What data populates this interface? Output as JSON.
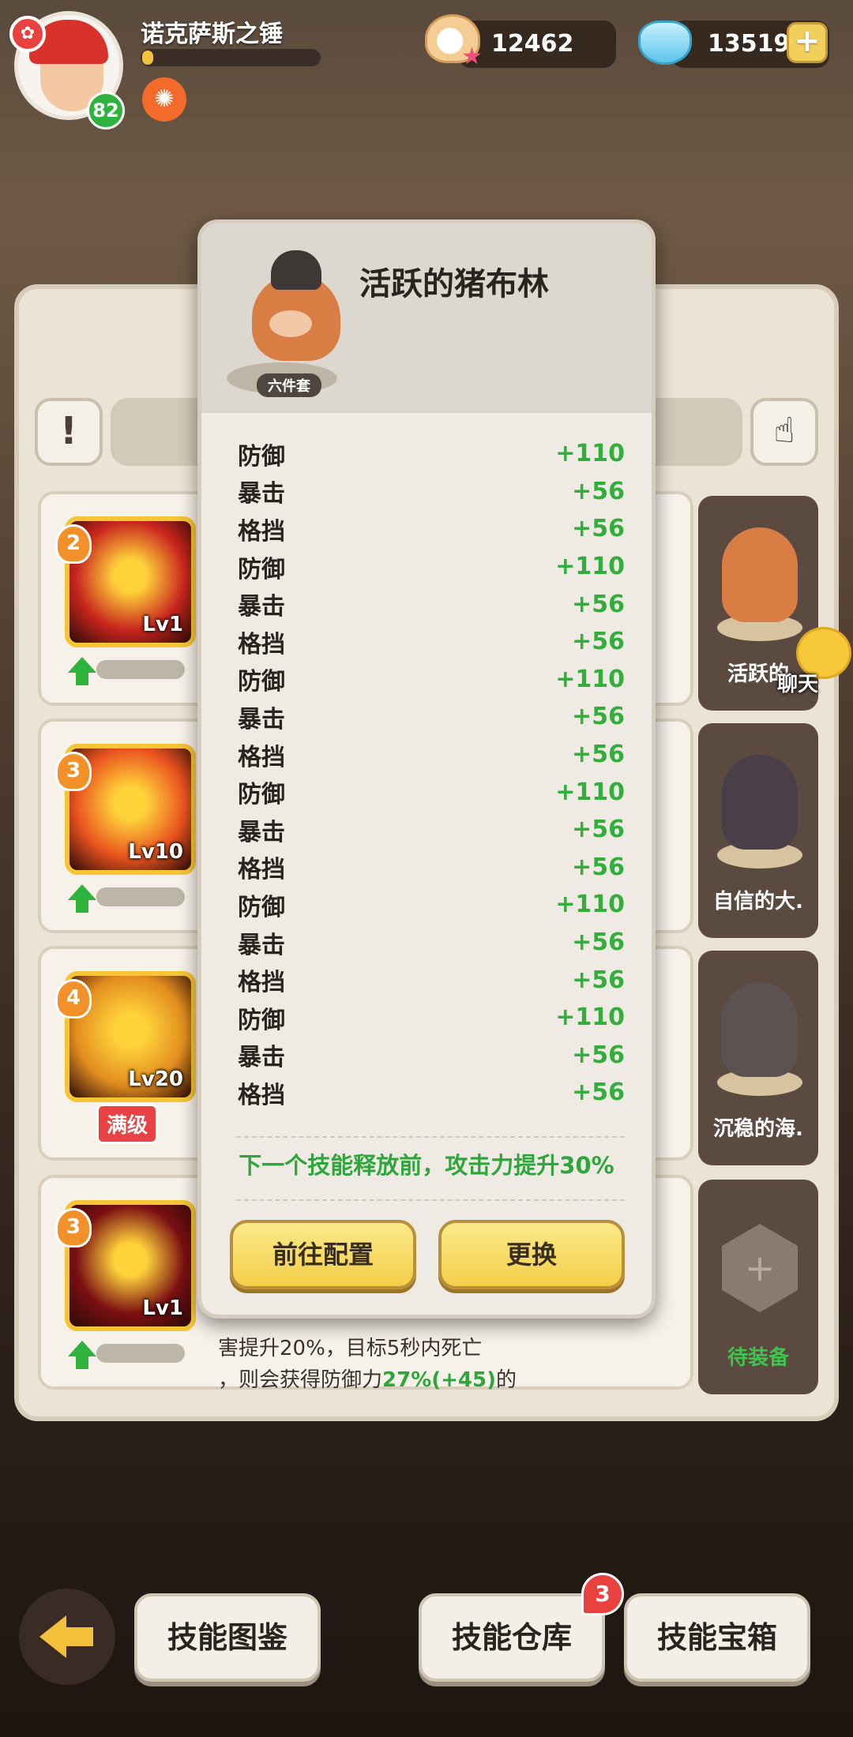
{
  "player": {
    "name": "诺克萨斯之锤",
    "level": "82",
    "xp_fraction": 0.06
  },
  "currencies": {
    "pearl": "12462",
    "crystal": "13519"
  },
  "skills": [
    {
      "rank": "2",
      "level": "Lv1",
      "color": "#c8261d"
    },
    {
      "rank": "3",
      "level": "Lv10",
      "color": "#e9531e"
    },
    {
      "rank": "4",
      "level": "Lv20",
      "color": "#e28d1f",
      "max_label": "满级"
    },
    {
      "rank": "3",
      "level": "Lv1",
      "color": "#7a0f12"
    }
  ],
  "equipment": [
    {
      "name": "活跃的",
      "set_tag": "六件套"
    },
    {
      "name": "自信的大."
    },
    {
      "name": "沉稳的海."
    },
    {
      "name": "待装备"
    }
  ],
  "chat_label": "聊天",
  "skill_desc_peek": {
    "line1": "害提升20%，目标5秒内死亡",
    "line2_prefix": "，则会获得防御力",
    "line2_value": "27%(+45)",
    "line2_suffix": "的"
  },
  "tooltip": {
    "title": "活跃的猪布林",
    "set_tag": "六件套",
    "stats": [
      {
        "name": "防御",
        "value": "+110"
      },
      {
        "name": "暴击",
        "value": "+56"
      },
      {
        "name": "格挡",
        "value": "+56"
      },
      {
        "name": "防御",
        "value": "+110"
      },
      {
        "name": "暴击",
        "value": "+56"
      },
      {
        "name": "格挡",
        "value": "+56"
      },
      {
        "name": "防御",
        "value": "+110"
      },
      {
        "name": "暴击",
        "value": "+56"
      },
      {
        "name": "格挡",
        "value": "+56"
      },
      {
        "name": "防御",
        "value": "+110"
      },
      {
        "name": "暴击",
        "value": "+56"
      },
      {
        "name": "格挡",
        "value": "+56"
      },
      {
        "name": "防御",
        "value": "+110"
      },
      {
        "name": "暴击",
        "value": "+56"
      },
      {
        "name": "格挡",
        "value": "+56"
      },
      {
        "name": "防御",
        "value": "+110"
      },
      {
        "name": "暴击",
        "value": "+56"
      },
      {
        "name": "格挡",
        "value": "+56"
      }
    ],
    "set_effect": "下一个技能释放前，攻击力提升30%",
    "buttons": {
      "configure": "前往配置",
      "replace": "更换"
    }
  },
  "bottom_nav": {
    "codex": "技能图鉴",
    "storage": "技能仓库",
    "storage_badge": "3",
    "chest": "技能宝箱"
  }
}
